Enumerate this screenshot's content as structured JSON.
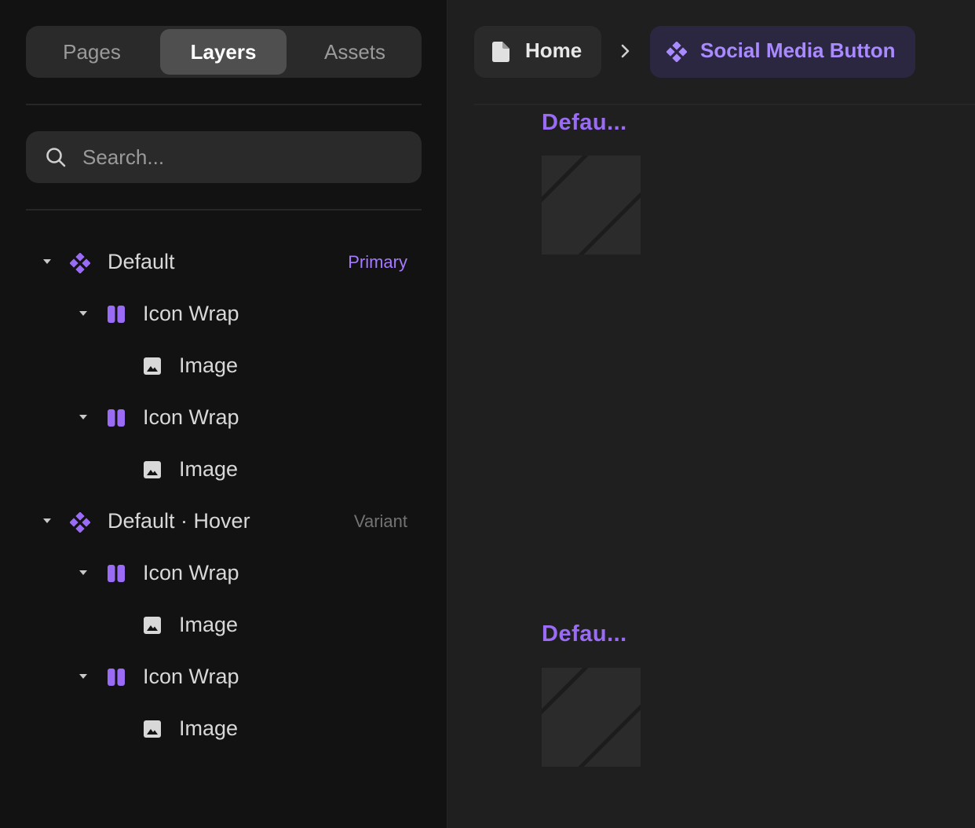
{
  "sidebar": {
    "tabs": [
      {
        "label": "Pages",
        "active": false
      },
      {
        "label": "Layers",
        "active": true
      },
      {
        "label": "Assets",
        "active": false
      }
    ],
    "search": {
      "placeholder": "Search..."
    },
    "layers": [
      {
        "label": "Default",
        "type": "component",
        "badge": "Primary"
      },
      {
        "label": "Icon Wrap",
        "type": "stack"
      },
      {
        "label": "Image",
        "type": "image"
      },
      {
        "label": "Icon Wrap",
        "type": "stack"
      },
      {
        "label": "Image",
        "type": "image"
      },
      {
        "label": "Default · Hover",
        "type": "component",
        "badge": "Variant"
      },
      {
        "label": "Icon Wrap",
        "type": "stack"
      },
      {
        "label": "Image",
        "type": "image"
      },
      {
        "label": "Icon Wrap",
        "type": "stack"
      },
      {
        "label": "Image",
        "type": "image"
      }
    ]
  },
  "breadcrumb": {
    "home": "Home",
    "component": "Social Media Button"
  },
  "canvas": {
    "frames": [
      {
        "label": "Defau..."
      },
      {
        "label": "Defau..."
      }
    ]
  },
  "colors": {
    "accent": "#9a6cf6",
    "sidebar_bg": "#121212",
    "canvas_bg": "#1f1f1f"
  }
}
